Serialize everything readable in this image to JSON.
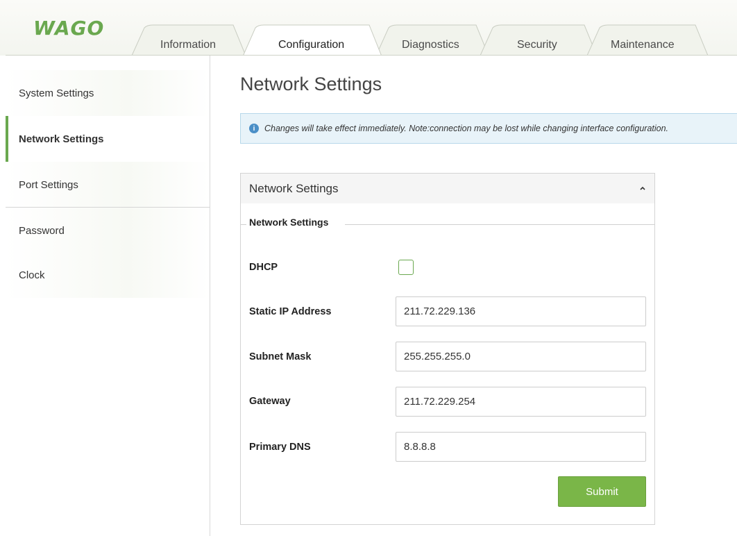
{
  "brand": {
    "logo_text": "WAGO",
    "accent_color": "#7ab648",
    "logo_color": "#6aa84f"
  },
  "tabs": [
    {
      "label": "Information",
      "active": false
    },
    {
      "label": "Configuration",
      "active": true
    },
    {
      "label": "Diagnostics",
      "active": false
    },
    {
      "label": "Security",
      "active": false
    },
    {
      "label": "Maintenance",
      "active": false
    }
  ],
  "sidebar": {
    "items": [
      {
        "label": "System Settings",
        "active": false
      },
      {
        "label": "Network Settings",
        "active": true
      },
      {
        "label": "Port Settings",
        "active": false
      },
      {
        "label": "Password",
        "active": false
      },
      {
        "label": "Clock",
        "active": false
      }
    ]
  },
  "main": {
    "title": "Network Settings",
    "info": {
      "icon": "info-icon",
      "text": "Changes will take effect immediately. Note:connection may be lost while changing interface configuration."
    },
    "panel": {
      "header": "Network Settings",
      "collapse_icon": "chevron-up-icon",
      "legend": "Network Settings",
      "dhcp": {
        "label": "DHCP",
        "checked": false
      },
      "fields": {
        "static_ip": {
          "label": "Static IP Address",
          "value": "211.72.229.136"
        },
        "subnet": {
          "label": "Subnet Mask",
          "value": "255.255.255.0"
        },
        "gateway": {
          "label": "Gateway",
          "value": "211.72.229.254"
        },
        "dns": {
          "label": "Primary DNS",
          "value": "8.8.8.8"
        }
      },
      "submit_label": "Submit"
    }
  }
}
